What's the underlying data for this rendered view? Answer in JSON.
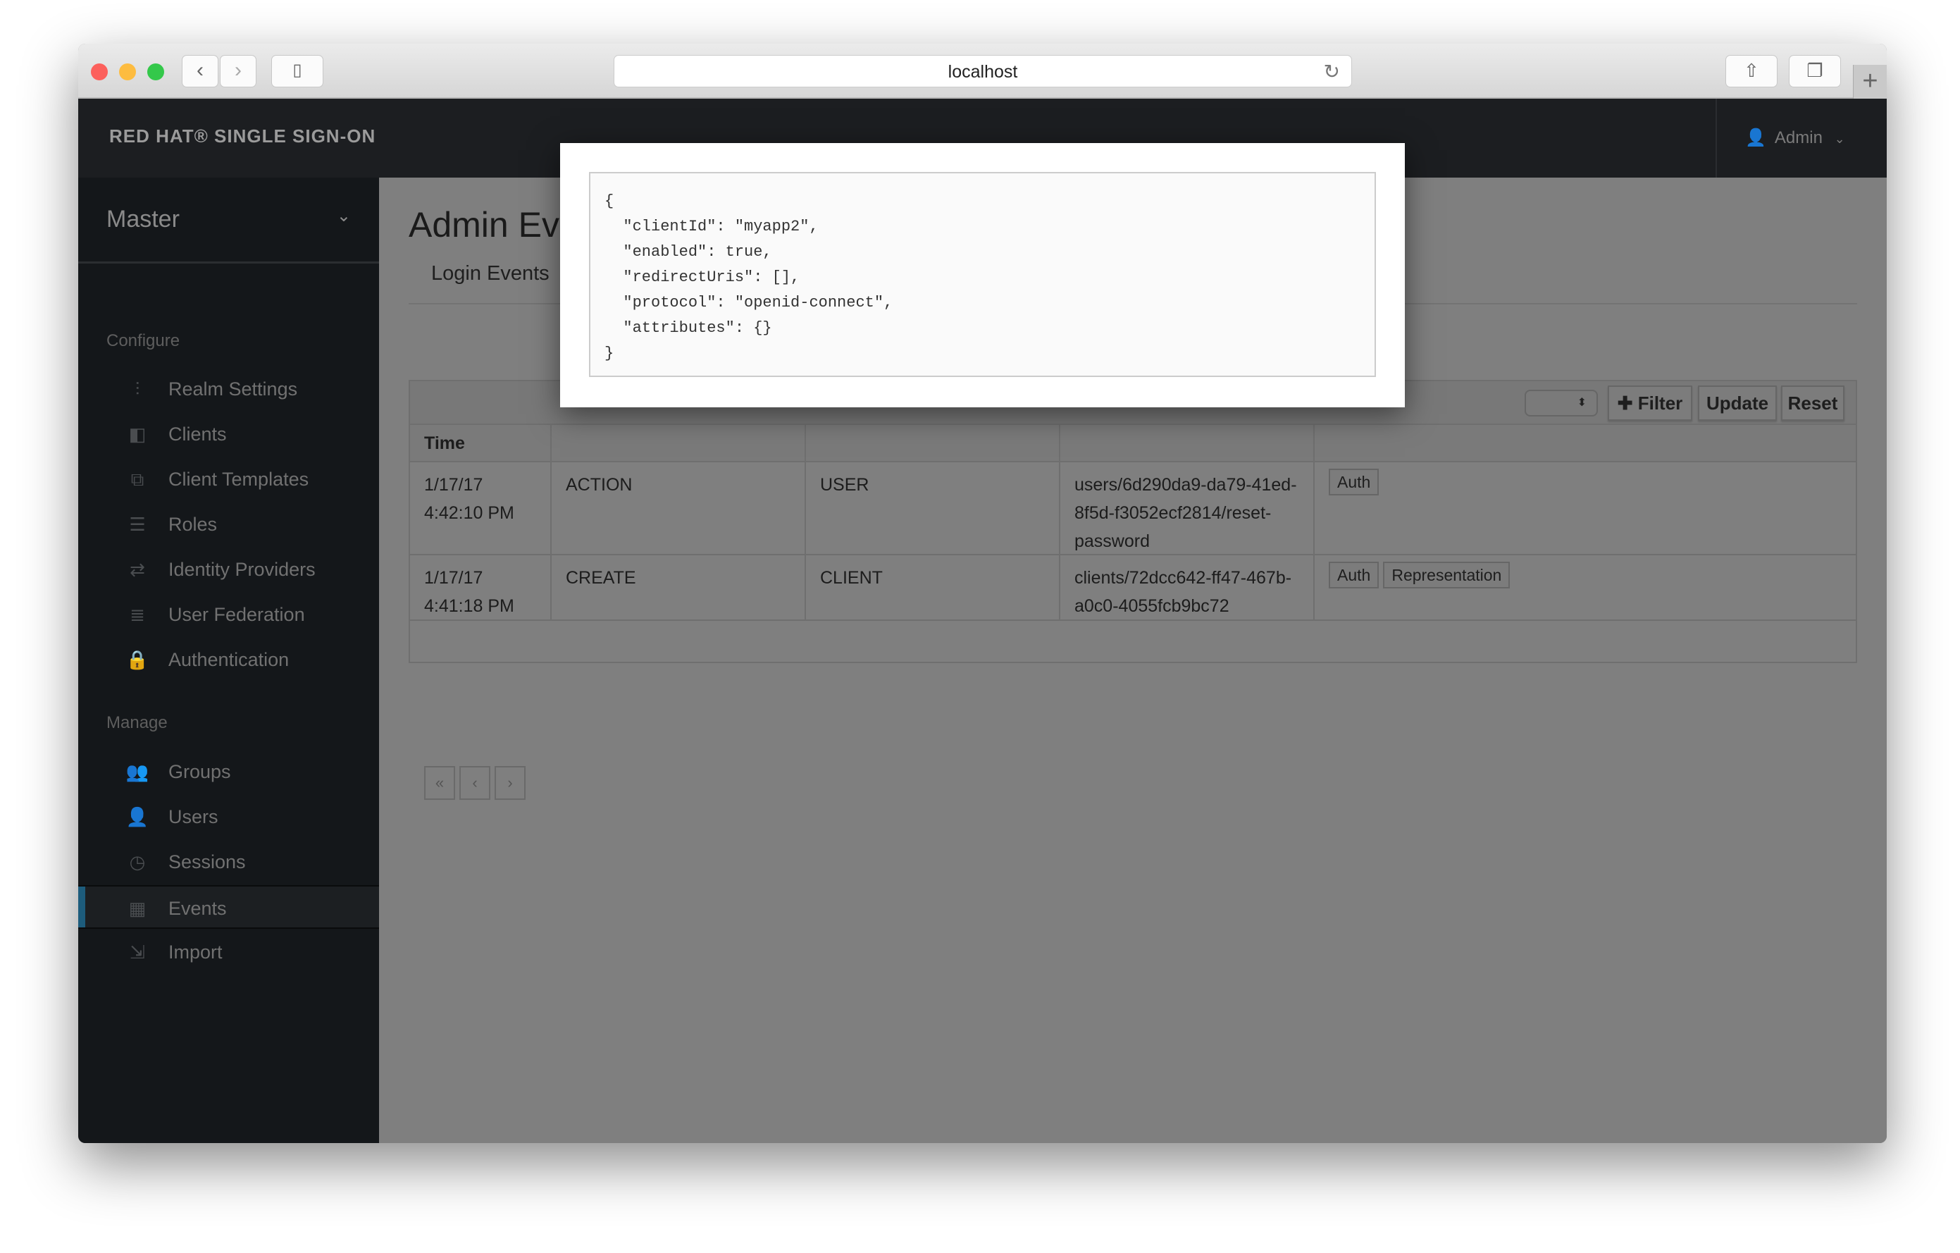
{
  "browser": {
    "url": "localhost",
    "colors": {
      "close": "#fc605c",
      "minimize": "#fdbc40",
      "zoom": "#34c84a"
    }
  },
  "header": {
    "brand": "RED HAT® SINGLE SIGN-ON",
    "user": "Admin"
  },
  "sidebar": {
    "realm": "Master",
    "configure_label": "Configure",
    "configure": [
      {
        "label": "Realm Settings",
        "icon": "sliders-icon"
      },
      {
        "label": "Clients",
        "icon": "cube-icon"
      },
      {
        "label": "Client Templates",
        "icon": "cubes-icon"
      },
      {
        "label": "Roles",
        "icon": "list-icon"
      },
      {
        "label": "Identity Providers",
        "icon": "exchange-icon"
      },
      {
        "label": "User Federation",
        "icon": "database-icon"
      },
      {
        "label": "Authentication",
        "icon": "lock-icon"
      }
    ],
    "manage_label": "Manage",
    "manage": [
      {
        "label": "Groups",
        "icon": "users-icon"
      },
      {
        "label": "Users",
        "icon": "user-icon"
      },
      {
        "label": "Sessions",
        "icon": "clock-icon"
      },
      {
        "label": "Events",
        "icon": "calendar-icon",
        "active": true
      },
      {
        "label": "Import",
        "icon": "import-icon"
      }
    ],
    "active_color": "#1d5c7c"
  },
  "main": {
    "title": "Admin Events",
    "tabs": [
      {
        "label": "Login Events"
      }
    ],
    "toolbar": {
      "filter": "Filter",
      "update": "Update",
      "reset": "Reset"
    },
    "table": {
      "headers": [
        "Time"
      ],
      "rows": [
        {
          "time": [
            "1/17/17",
            "4:42:10 PM"
          ],
          "operation": "ACTION",
          "resource_type": "USER",
          "resource_path": "users/6d290da9-da79-41ed-8f5d-f3052ecf2814/reset-password",
          "actions": [
            "Auth"
          ]
        },
        {
          "time": [
            "1/17/17",
            "4:41:18 PM"
          ],
          "operation": "CREATE",
          "resource_type": "CLIENT",
          "resource_path": "clients/72dcc642-ff47-467b-a0c0-4055fcb9bc72",
          "actions": [
            "Auth",
            "Representation"
          ]
        }
      ]
    },
    "pager": [
      "«",
      "‹",
      "›"
    ]
  },
  "modal": {
    "json": "{\n  \"clientId\": \"myapp2\",\n  \"enabled\": true,\n  \"redirectUris\": [],\n  \"protocol\": \"openid-connect\",\n  \"attributes\": {}\n}"
  }
}
